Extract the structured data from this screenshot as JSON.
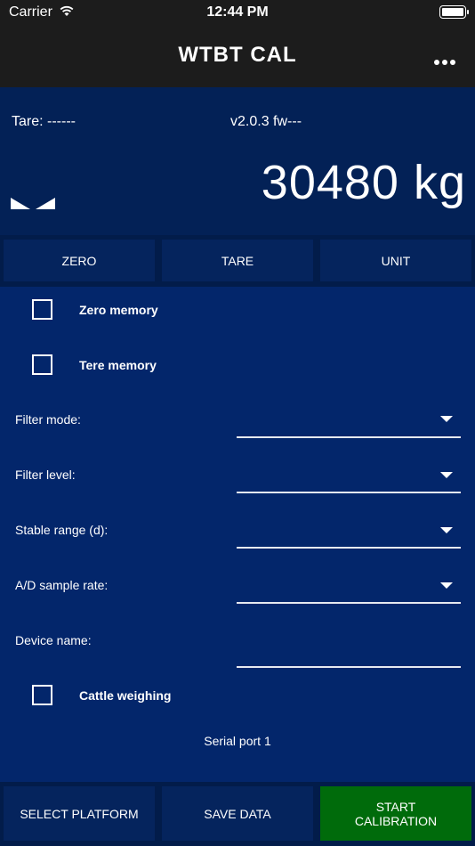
{
  "status_bar": {
    "carrier": "Carrier",
    "time": "12:44 PM"
  },
  "nav": {
    "title": "WTBT CAL"
  },
  "display": {
    "tare": "Tare: ------",
    "version": "v2.0.3 fw---",
    "weight": "30480 kg"
  },
  "buttons": {
    "zero": "ZERO",
    "tare": "TARE",
    "unit": "UNIT"
  },
  "form": {
    "zero_memory": "Zero memory",
    "tare_memory": "Tere memory",
    "filter_mode": "Filter mode:",
    "filter_level": "Filter level:",
    "stable_range": "Stable range (d):",
    "ad_sample_rate": "A/D sample rate:",
    "device_name": "Device name:",
    "cattle_weighing": "Cattle weighing",
    "serial_port": "Serial port 1"
  },
  "bottom": {
    "select_platform": "SELECT PLATFORM",
    "save_data": "SAVE DATA",
    "start_calibration_1": "START",
    "start_calibration_2": "CALIBRATION"
  },
  "colors": {
    "background": "#03266b",
    "display_bg": "#032156",
    "button_bg": "#05245d",
    "start_button": "#006b0b",
    "bar_bg": "#1c1c1c"
  }
}
